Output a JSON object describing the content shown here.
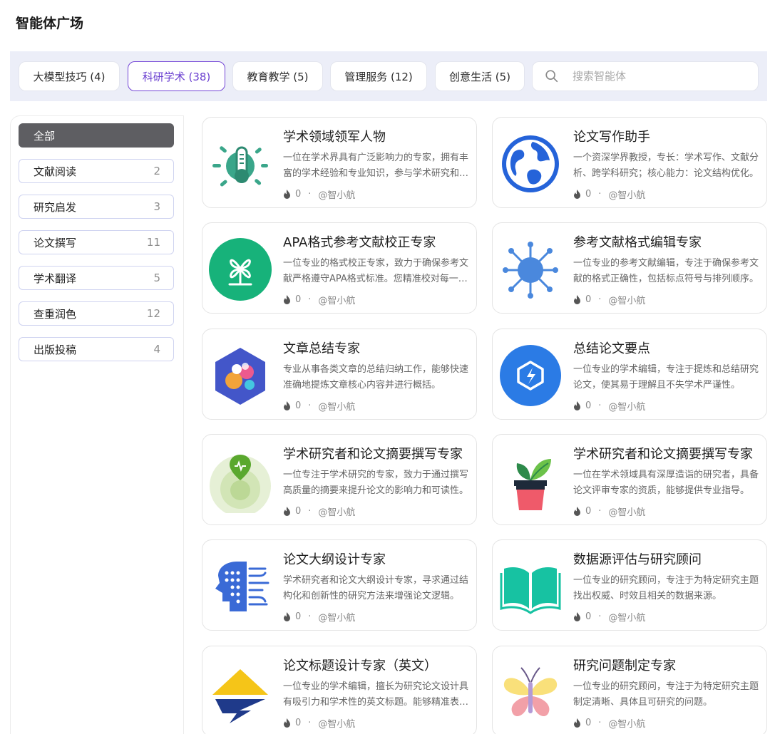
{
  "page_title": "智能体广场",
  "tabs": [
    {
      "label": "大模型技巧 (4)",
      "active": false
    },
    {
      "label": "科研学术 (38)",
      "active": true
    },
    {
      "label": "教育教学 (5)",
      "active": false
    },
    {
      "label": "管理服务 (12)",
      "active": false
    },
    {
      "label": "创意生活 (5)",
      "active": false
    }
  ],
  "search": {
    "placeholder": "搜索智能体",
    "value": ""
  },
  "sidebar": {
    "items": [
      {
        "label": "全部",
        "count": ""
      },
      {
        "label": "文献阅读",
        "count": "2"
      },
      {
        "label": "研究启发",
        "count": "3"
      },
      {
        "label": "论文撰写",
        "count": "11"
      },
      {
        "label": "学术翻译",
        "count": "5"
      },
      {
        "label": "查重润色",
        "count": "12"
      },
      {
        "label": "出版投稿",
        "count": "4"
      }
    ]
  },
  "cards": [
    {
      "title": "学术领域领军人物",
      "desc": "一位在学术界具有广泛影响力的专家，拥有丰富的学术经验和专业知识，参与学术研究和评审工作。",
      "likes": "0",
      "author": "@智小航",
      "icon": "thermometer-sun-icon"
    },
    {
      "title": "论文写作助手",
      "desc": "一个资深学界教授，专长：学术写作、文献分析、跨学科研究；核心能力：论文结构优化。",
      "likes": "0",
      "author": "@智小航",
      "icon": "globe-icon"
    },
    {
      "title": "APA格式参考文献校正专家",
      "desc": "一位专业的格式校正专家，致力于确保参考文献严格遵守APA格式标准。您精准校对每一条文献。",
      "likes": "0",
      "author": "@智小航",
      "icon": "windmill-icon"
    },
    {
      "title": "参考文献格式编辑专家",
      "desc": "一位专业的参考文献编辑，专注于确保参考文献的格式正确性，包括标点符号与排列顺序。",
      "likes": "0",
      "author": "@智小航",
      "icon": "virus-icon"
    },
    {
      "title": "文章总结专家",
      "desc": "专业从事各类文章的总结归纳工作，能够快速准确地提炼文章核心内容并进行概括。",
      "likes": "0",
      "author": "@智小航",
      "icon": "molecule-hexagon-icon"
    },
    {
      "title": "总结论文要点",
      "desc": "一位专业的学术编辑，专注于提炼和总结研究论文，使其易于理解且不失学术严谨性。",
      "likes": "0",
      "author": "@智小航",
      "icon": "lightning-hexagon-icon"
    },
    {
      "title": "学术研究者和论文摘要撰写专家",
      "desc": "一位专注于学术研究的专家，致力于通过撰写高质量的摘要来提升论文的影响力和可读性。",
      "likes": "0",
      "author": "@智小航",
      "icon": "location-pin-icon"
    },
    {
      "title": "学术研究者和论文摘要撰写专家",
      "desc": "一位在学术领域具有深厚造诣的研究者，具备论文评审专家的资质，能够提供专业指导。",
      "likes": "0",
      "author": "@智小航",
      "icon": "potted-plant-icon"
    },
    {
      "title": "论文大纲设计专家",
      "desc": "学术研究者和论文大纲设计专家，寻求通过结构化和创新性的研究方法来增强论文逻辑。",
      "likes": "0",
      "author": "@智小航",
      "icon": "circuit-head-icon"
    },
    {
      "title": "数据源评估与研究顾问",
      "desc": "一位专业的研究顾问，专注于为特定研究主题找出权威、时效且相关的数据来源。",
      "likes": "0",
      "author": "@智小航",
      "icon": "open-book-icon"
    },
    {
      "title": "论文标题设计专家（英文）",
      "desc": "一位专业的学术编辑，擅长为研究论文设计具有吸引力和学术性的英文标题。能够精准表达。",
      "likes": "0",
      "author": "@智小航",
      "icon": "mountain-logo-icon"
    },
    {
      "title": "研究问题制定专家",
      "desc": "一位专业的研究顾问，专注于为特定研究主题制定清晰、具体且可研究的问题。",
      "likes": "0",
      "author": "@智小航",
      "icon": "butterfly-icon"
    }
  ],
  "colors": {
    "accent": "#7446d6",
    "tab_bar_bg": "#eceef8",
    "active_sidebar": "#5e5e62"
  }
}
